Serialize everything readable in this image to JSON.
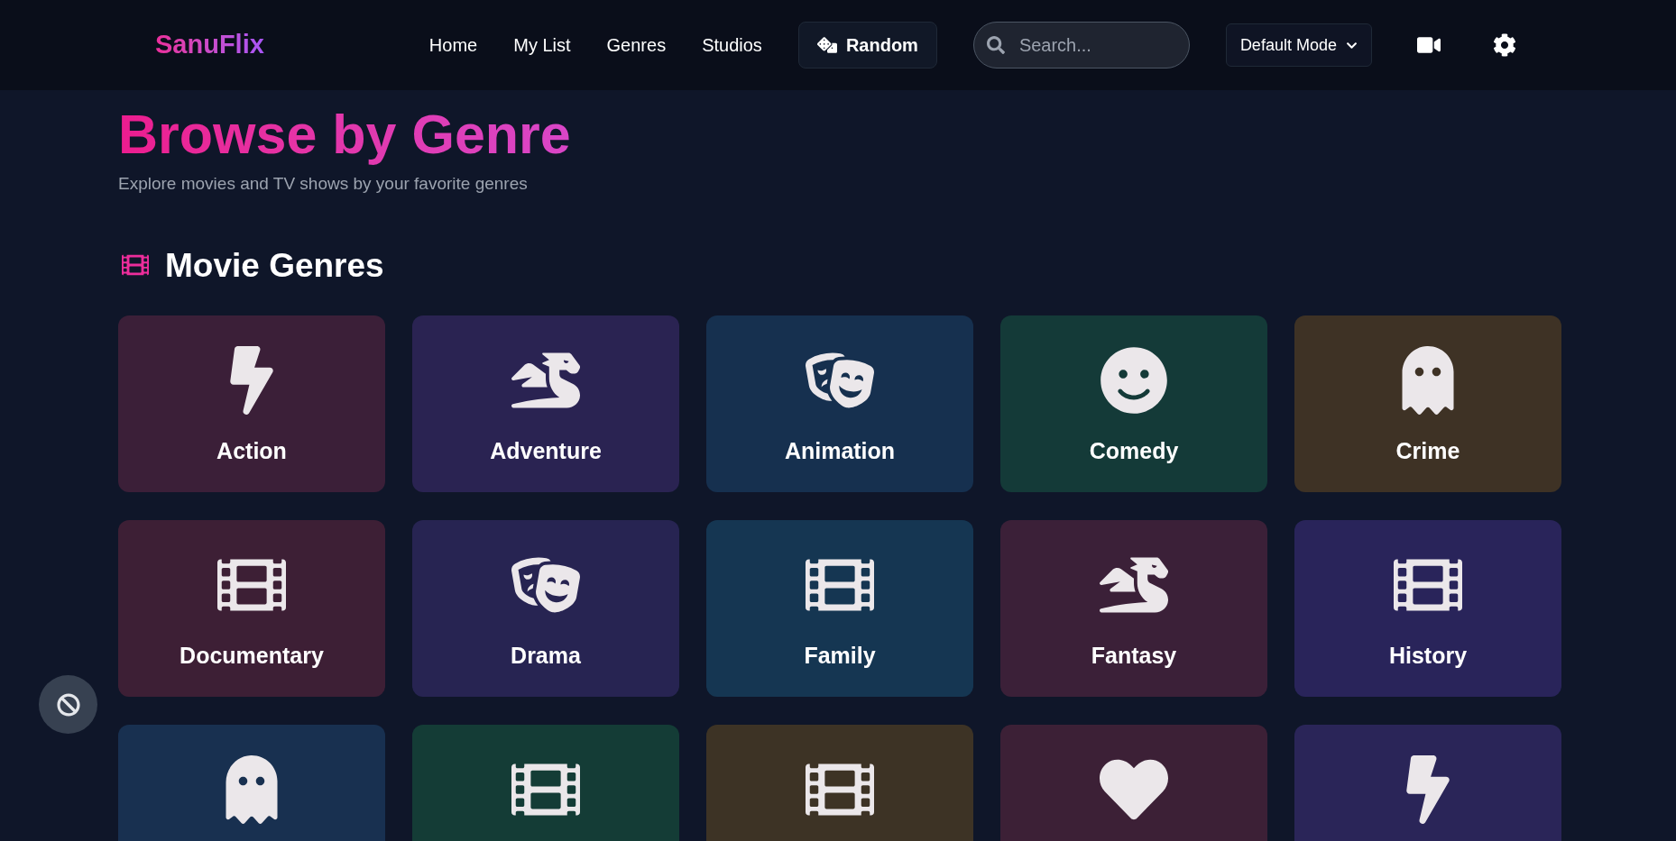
{
  "header": {
    "logo": "SanuFlix",
    "nav": [
      {
        "label": "Home"
      },
      {
        "label": "My List"
      },
      {
        "label": "Genres"
      },
      {
        "label": "Studios"
      }
    ],
    "random_button": "Random",
    "search": {
      "placeholder": "Search..."
    },
    "mode_dropdown": "Default Mode"
  },
  "page": {
    "title": "Browse by Genre",
    "subtitle": "Explore movies and TV shows by your favorite genres"
  },
  "section": {
    "title": "Movie Genres",
    "genres": [
      {
        "label": "Action",
        "kind": "bolt",
        "color": "#3b1f38"
      },
      {
        "label": "Adventure",
        "kind": "dragon",
        "color": "#2a2352"
      },
      {
        "label": "Animation",
        "kind": "masks",
        "color": "#16304f"
      },
      {
        "label": "Comedy",
        "kind": "smile",
        "color": "#143a38"
      },
      {
        "label": "Crime",
        "kind": "ghost",
        "color": "#3e3225"
      },
      {
        "label": "Documentary",
        "kind": "film",
        "color": "#3d1f35"
      },
      {
        "label": "Drama",
        "kind": "masks",
        "color": "#272452"
      },
      {
        "label": "Family",
        "kind": "film",
        "color": "#153652"
      },
      {
        "label": "Fantasy",
        "kind": "dragon",
        "color": "#3b2038"
      },
      {
        "label": "History",
        "kind": "film",
        "color": "#29245a"
      },
      {
        "kind": "ghost",
        "color": "#183050"
      },
      {
        "kind": "film",
        "color": "#143c36"
      },
      {
        "kind": "film",
        "color": "#3d3325"
      },
      {
        "kind": "heart",
        "color": "#3c2036"
      },
      {
        "kind": "bolt",
        "color": "#2a2558"
      }
    ]
  }
}
